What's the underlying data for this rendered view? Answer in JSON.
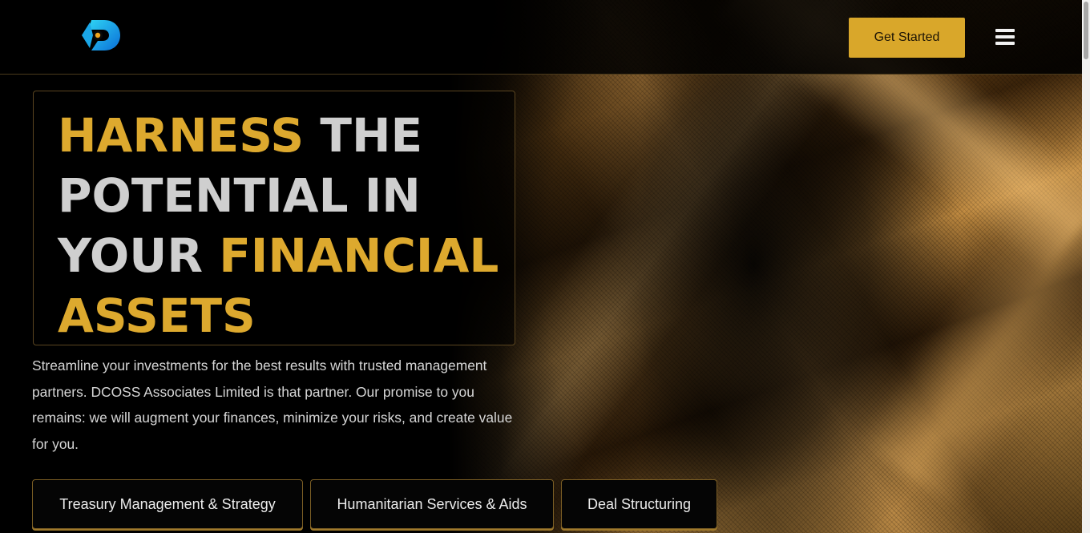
{
  "header": {
    "logo_icon": "dcoss-d-logo-icon",
    "cta_label": "Get Started",
    "menu_icon": "hamburger-menu-icon",
    "accent_color": "#d9a72a"
  },
  "hero": {
    "title_parts": [
      {
        "text": "HARNESS",
        "color": "gold"
      },
      {
        "text": " THE",
        "color": "grey"
      },
      {
        "text": "POTENTIAL IN",
        "color": "grey"
      },
      {
        "text": "YOUR ",
        "color": "grey"
      },
      {
        "text": "FINANCIAL",
        "color": "gold"
      },
      {
        "text": "ASSETS",
        "color": "gold"
      }
    ],
    "description": "Streamline your investments for the best results with trusted management partners. DCOSS Associates Limited is that partner. Our promise to you remains: we will augment your finances, minimize your risks, and create value for you."
  },
  "services": [
    {
      "label": "Treasury Management & Strategy"
    },
    {
      "label": "Humanitarian Services & Aids"
    },
    {
      "label": "Deal Structuring"
    }
  ]
}
